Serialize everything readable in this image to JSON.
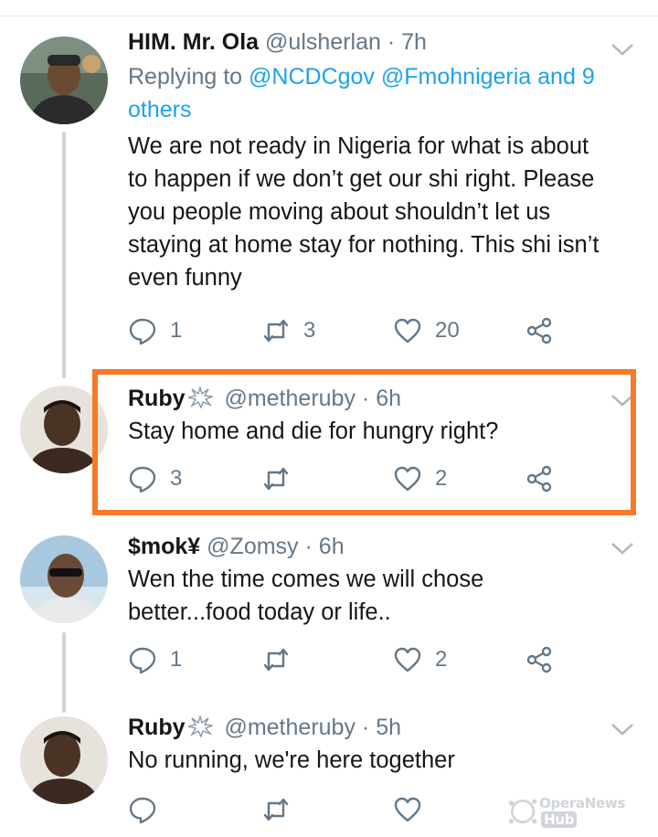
{
  "tweets": [
    {
      "name": "HIM. Mr. Ola",
      "handle": "@ulsherlan",
      "sep": "·",
      "time": "7h",
      "reply_prefix": "Replying to ",
      "reply_links": "@NCDCgov @Fmohnigeria and 9",
      "reply_links_2": "others",
      "text_lines": [
        "We are not ready in Nigeria for what is about",
        "to happen if we don’t get our shi right. Please",
        "you people moving about shouldn’t let us",
        "staying at home stay for nothing. This shi isn’t",
        "even funny"
      ],
      "replies": "1",
      "retweets": "3",
      "likes": "20"
    },
    {
      "name": "Ruby",
      "handle": "@metheruby",
      "sep": "·",
      "time": "6h",
      "text_lines": [
        "Stay home and die for hungry right?"
      ],
      "replies": "3",
      "retweets": "",
      "likes": "2"
    },
    {
      "name": "$mok¥",
      "handle": "@Zomsy",
      "sep": "·",
      "time": "6h",
      "text_lines": [
        "Wen the time comes we will chose",
        "better...food today or life.."
      ],
      "replies": "1",
      "retweets": "",
      "likes": "2"
    },
    {
      "name": "Ruby",
      "handle": "@metheruby",
      "sep": "·",
      "time": "5h",
      "text_lines": [
        "No running, we're here together"
      ],
      "replies": "",
      "retweets": "",
      "likes": ""
    }
  ],
  "watermark": {
    "text": "OperaNews",
    "hub": "Hub"
  },
  "colors": {
    "link": "#1da1f2",
    "muted": "#657786",
    "highlight": "#f47a26",
    "thread_line": "#ccd6dd"
  }
}
